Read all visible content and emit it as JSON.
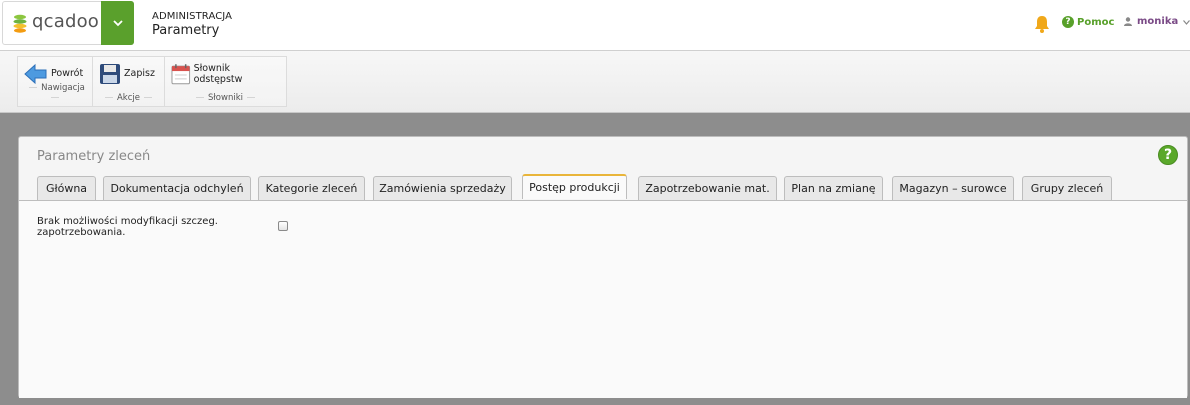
{
  "header": {
    "logo_text": "qcadoo",
    "section": "ADMINISTRACJA",
    "title": "Parametry",
    "help_label": "Pomoc",
    "user_name": "monika"
  },
  "ribbon": {
    "groups": [
      {
        "label": "Nawigacja",
        "buttons": [
          {
            "label": "Powrót",
            "icon": "back-arrow-icon"
          }
        ]
      },
      {
        "label": "Akcje",
        "buttons": [
          {
            "label": "Zapisz",
            "icon": "save-disk-icon"
          }
        ]
      },
      {
        "label": "Słowniki",
        "buttons": [
          {
            "label": "Słownik odstępstw",
            "icon": "calendar-icon"
          }
        ]
      }
    ]
  },
  "panel": {
    "title": "Parametry zleceń",
    "tabs": [
      {
        "label": "Główna"
      },
      {
        "label": "Dokumentacja odchyleń"
      },
      {
        "label": "Kategorie zleceń"
      },
      {
        "label": "Zamówienia sprzedaży"
      },
      {
        "label": "Postęp produkcji"
      },
      {
        "label": "Zapotrzebowanie mat."
      },
      {
        "label": "Plan na zmianę"
      },
      {
        "label": "Magazyn – surowce"
      },
      {
        "label": "Grupy zleceń"
      }
    ],
    "active_tab": "Postęp produkcji",
    "field": {
      "label": "Brak możliwości modyfikacji szczeg. zapotrzebowania.",
      "checked": false
    }
  },
  "colors": {
    "accent_green": "#5aa02c",
    "active_tab_border": "#e9b53a",
    "user_purple": "#7a4a86",
    "bell": "#f0a81a"
  }
}
